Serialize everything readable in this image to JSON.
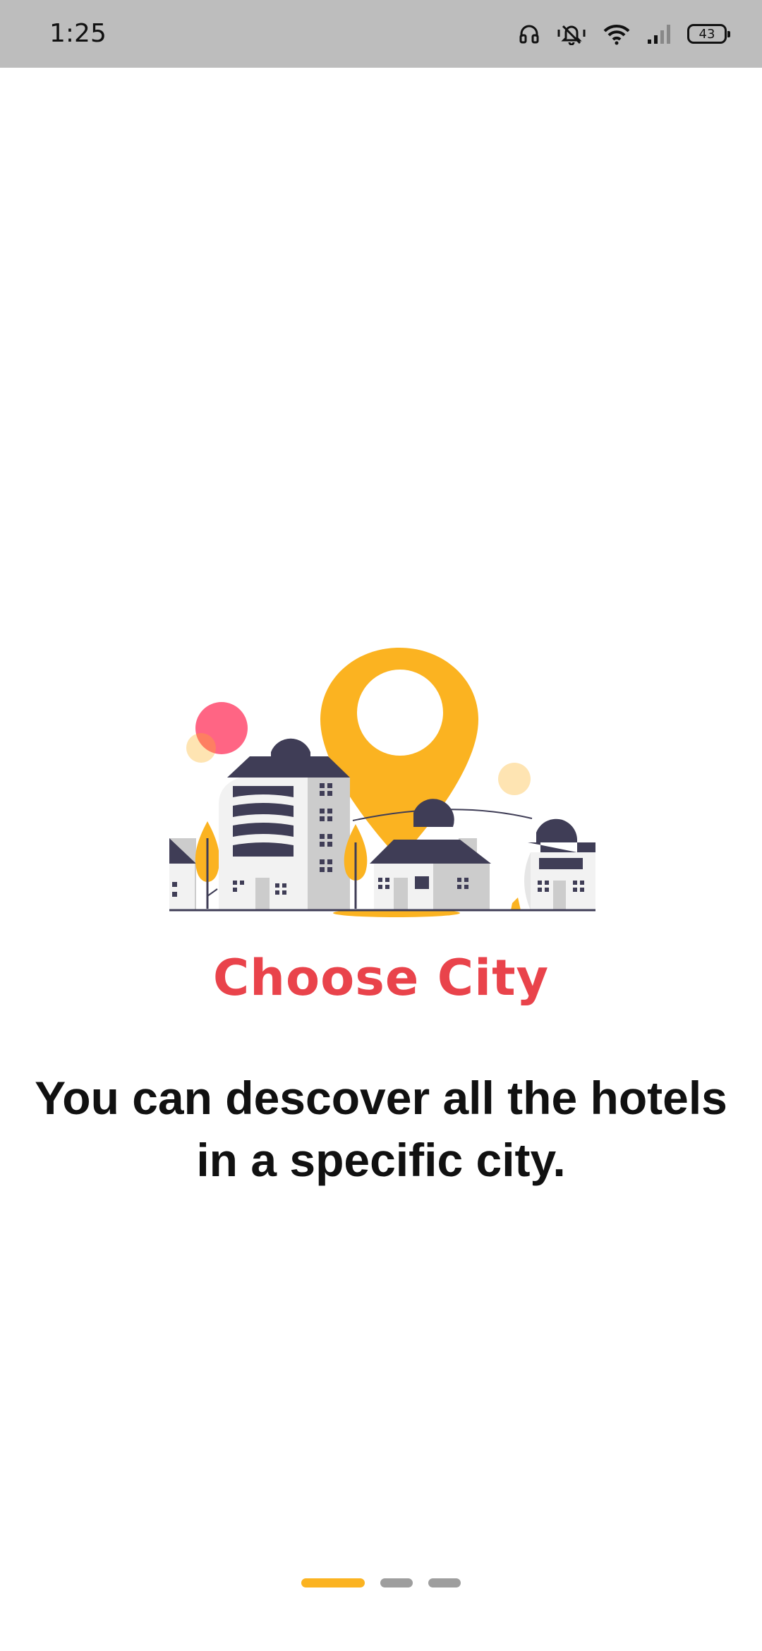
{
  "status_bar": {
    "time": "1:25",
    "battery": "43",
    "icons": [
      "headphones-icon",
      "vibrate-icon",
      "wifi-icon",
      "signal-icon",
      "battery-icon"
    ]
  },
  "onboarding": {
    "title": "Choose City",
    "description": "You can descover all the hotels in a specific city.",
    "illustration": "city-location-pin-illustration"
  },
  "pager": {
    "total": 3,
    "active_index": 0
  },
  "colors": {
    "accent": "#fbb321",
    "title": "#e9434b",
    "building_dark": "#3f3d56",
    "pink_circle": "#ff6584",
    "status_bar": "#bdbdbd"
  }
}
